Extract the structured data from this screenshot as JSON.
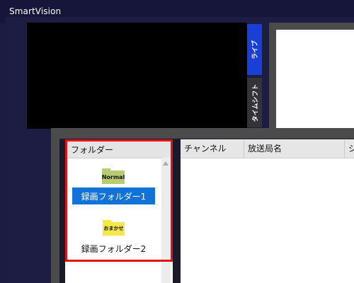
{
  "app": {
    "title": "SmartVision"
  },
  "side_tabs": {
    "live": "ライブ",
    "timeshift": "タイムシフト"
  },
  "folders": {
    "header": "フォルダー",
    "items": [
      {
        "icon_text": "Normal",
        "label": "録画フォルダー1",
        "selected": true
      },
      {
        "icon_text": "おまかせ",
        "icon_text_line1": "おま",
        "icon_text_line2": "かせ",
        "label": "録画フォルダー2",
        "selected": false
      }
    ]
  },
  "list": {
    "columns": [
      "チャンネル",
      "放送局名",
      "シ"
    ]
  },
  "colors": {
    "selection": "#1173d8",
    "highlight_border": "#e41212",
    "live_tab": "#1a3fd6",
    "normal_folder": "#b7cc70",
    "osusume_folder": "#f6e84a"
  }
}
